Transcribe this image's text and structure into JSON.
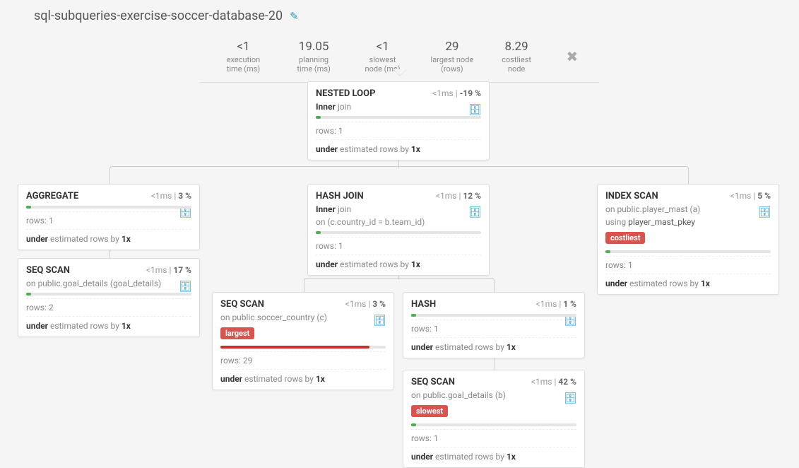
{
  "title": "sql-subqueries-exercise-soccer-database-20",
  "stats": {
    "execution_time": {
      "value": "<1",
      "label": "execution time (ms)"
    },
    "planning_time": {
      "value": "19.05",
      "label": "planning time (ms)"
    },
    "slowest_node": {
      "value": "<1",
      "label": "slowest node (ms)"
    },
    "largest_node": {
      "value": "29",
      "label": "largest node (rows)"
    },
    "costliest_node": {
      "value": "8.29",
      "label": "costliest node"
    }
  },
  "nodes": {
    "nested_loop": {
      "title": "NESTED LOOP",
      "time": "<1ms",
      "pct": "-19 %",
      "sub_bold": "Inner",
      "sub_rest": " join",
      "rows": "rows: 1",
      "est_pre": "under",
      "est_mid": " estimated rows by ",
      "est_val": "1x",
      "bar_width": "3%"
    },
    "aggregate": {
      "title": "AGGREGATE",
      "time": "<1ms",
      "pct": "3 %",
      "rows": "rows: 1",
      "est_pre": "under",
      "est_mid": " estimated rows by ",
      "est_val": "1x",
      "bar_width": "3%"
    },
    "seq_scan_gd": {
      "title": "SEQ SCAN",
      "time": "<1ms",
      "pct": "17 %",
      "sub": "on public.goal_details (goal_details)",
      "rows": "rows: 2",
      "est_pre": "under",
      "est_mid": " estimated rows by ",
      "est_val": "1x",
      "bar_width": "3%"
    },
    "hash_join": {
      "title": "HASH JOIN",
      "time": "<1ms",
      "pct": "12 %",
      "sub_bold": "Inner",
      "sub_rest": " join",
      "sub2": "on (c.country_id = b.team_id)",
      "rows": "rows: 1",
      "est_pre": "under",
      "est_mid": " estimated rows by ",
      "est_val": "1x",
      "bar_width": "3%"
    },
    "index_scan": {
      "title": "INDEX SCAN",
      "time": "<1ms",
      "pct": "5 %",
      "sub": "on public.player_mast (a)",
      "sub2_pre": "using ",
      "sub2_val": "player_mast_pkey",
      "badge": "costliest",
      "rows": "rows: 1",
      "est_pre": "under",
      "est_mid": " estimated rows by ",
      "est_val": "1x",
      "bar_width": "3%"
    },
    "seq_scan_sc": {
      "title": "SEQ SCAN",
      "time": "<1ms",
      "pct": "3 %",
      "sub": "on public.soccer_country (c)",
      "badge": "largest",
      "rows": "rows: 29",
      "est_pre": "under",
      "est_mid": " estimated rows by ",
      "est_val": "1x",
      "bar_width": "90%"
    },
    "hash": {
      "title": "HASH",
      "time": "<1ms",
      "pct": "1 %",
      "rows": "rows: 1",
      "est_pre": "under",
      "est_mid": " estimated rows by ",
      "est_val": "1x",
      "bar_width": "3%"
    },
    "seq_scan_gdb": {
      "title": "SEQ SCAN",
      "time": "<1ms",
      "pct": "42 %",
      "sub": "on public.goal_details (b)",
      "badge": "slowest",
      "rows": "rows: 1",
      "est_pre": "under",
      "est_mid": " estimated rows by ",
      "est_val": "1x",
      "bar_width": "3%"
    }
  }
}
